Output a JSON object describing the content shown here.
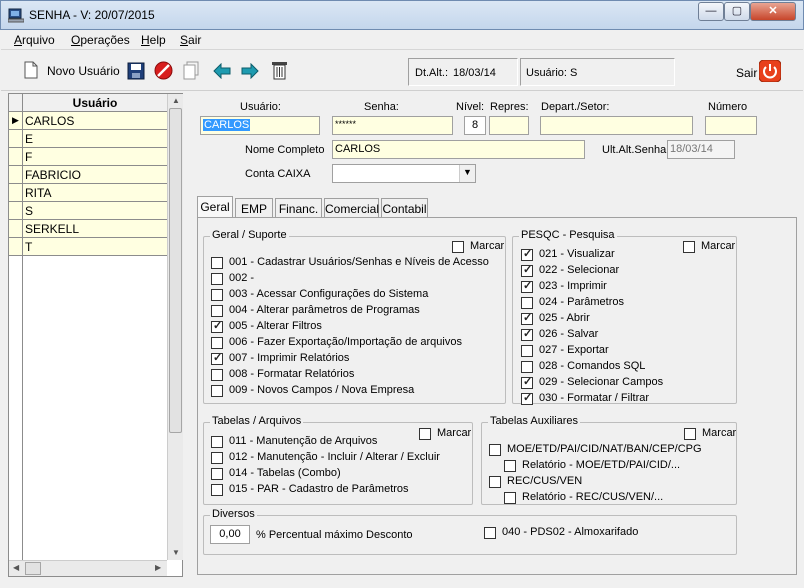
{
  "window": {
    "title": "SENHA - V: 20/07/2015",
    "minimize_glyph": "—",
    "maximize_glyph": "▢",
    "close_glyph": "✕"
  },
  "menu": {
    "items": [
      {
        "label": "Arquivo",
        "accel": "A",
        "rest": "rquivo"
      },
      {
        "label": "Operações",
        "accel": "O",
        "rest": "perações"
      },
      {
        "label": "Help",
        "accel": "H",
        "rest": "elp"
      },
      {
        "label": "Sair",
        "accel": "S",
        "rest": "air"
      }
    ]
  },
  "toolbar": {
    "new_user_label": "Novo Usuário",
    "dt_alt_label": "Dt.Alt.:",
    "dt_alt_value": "18/03/14",
    "usuario_label": "Usuário:",
    "usuario_value": "S",
    "exit_label": "Sair",
    "icons": [
      "new-document-icon",
      "save-icon",
      "cancel-icon",
      "copy-icon",
      "arrow-left-icon",
      "arrow-right-icon",
      "trash-icon",
      "power-icon"
    ]
  },
  "grid": {
    "header": "Usuário",
    "rows": [
      "CARLOS",
      "E",
      "F",
      "FABRICIO",
      "RITA",
      "S",
      "SERKELL",
      "T"
    ],
    "current_row_marker": "▶"
  },
  "form": {
    "usuario_label": "Usuário:",
    "usuario_value": "CARLOS",
    "senha_label": "Senha:",
    "senha_value": "******",
    "nivel_label": "Nível:",
    "nivel_value": "8",
    "repres_label": "Repres:",
    "repres_value": "",
    "depart_label": "Depart./Setor:",
    "depart_value": "",
    "numero_label": "Número",
    "numero_value": "",
    "nome_label": "Nome Completo",
    "nome_value": "CARLOS",
    "ult_alt_label": "Ult.Alt.Senha",
    "ult_alt_value": "18/03/14",
    "conta_label": "Conta CAIXA",
    "conta_value": ""
  },
  "tabs": [
    "Geral",
    "EMP",
    "Financ.",
    "Comercial",
    "Contabil"
  ],
  "groups": {
    "geral": {
      "title": "Geral / Suporte",
      "marcar": "Marcar",
      "items": [
        {
          "label": "001 - Cadastrar Usuários/Senhas e Níveis de Acesso",
          "checked": false
        },
        {
          "label": "002 -",
          "checked": false
        },
        {
          "label": "003 - Acessar Configurações do Sistema",
          "checked": false
        },
        {
          "label": "004 - Alterar parâmetros de Programas",
          "checked": false
        },
        {
          "label": "005 - Alterar Filtros",
          "checked": true
        },
        {
          "label": "006 - Fazer Exportação/Importação de arquivos",
          "checked": false
        },
        {
          "label": "007 - Imprimir Relatórios",
          "checked": true
        },
        {
          "label": "008 - Formatar Relatórios",
          "checked": false
        },
        {
          "label": "009 - Novos Campos / Nova Empresa",
          "checked": false
        }
      ]
    },
    "pesqc": {
      "title": "PESQC - Pesquisa",
      "marcar": "Marcar",
      "items": [
        {
          "label": "021 - Visualizar",
          "checked": true
        },
        {
          "label": "022 - Selecionar",
          "checked": true
        },
        {
          "label": "023 - Imprimir",
          "checked": true
        },
        {
          "label": "024 - Parâmetros",
          "checked": false
        },
        {
          "label": "025 - Abrir",
          "checked": true
        },
        {
          "label": "026 - Salvar",
          "checked": true
        },
        {
          "label": "027 - Exportar",
          "checked": false
        },
        {
          "label": "028 - Comandos SQL",
          "checked": false
        },
        {
          "label": "029 - Selecionar Campos",
          "checked": true
        },
        {
          "label": "030 - Formatar / Filtrar",
          "checked": true
        }
      ]
    },
    "tabelas": {
      "title": "Tabelas / Arquivos",
      "marcar": "Marcar",
      "items": [
        {
          "label": "011 - Manutenção de Arquivos",
          "checked": false
        },
        {
          "label": "012 - Manutenção - Incluir / Alterar / Excluir",
          "checked": false
        },
        {
          "label": "014 - Tabelas (Combo)",
          "checked": false
        },
        {
          "label": "015 - PAR - Cadastro de  Parâmetros",
          "checked": false
        }
      ]
    },
    "auxiliares": {
      "title": "Tabelas Auxiliares",
      "marcar": "Marcar",
      "items": [
        {
          "label": "MOE/ETD/PAI/CID/NAT/BAN/CEP/CPG",
          "checked": false
        },
        {
          "label": "Relatório - MOE/ETD/PAI/CID/...",
          "checked": false
        },
        {
          "label": "REC/CUS/VEN",
          "checked": false
        },
        {
          "label": "Relatório - REC/CUS/VEN/...",
          "checked": false
        }
      ]
    },
    "diversos": {
      "title": "Diversos",
      "percent_value": "0,00",
      "percent_label": "% Percentual máximo Desconto",
      "pds_label": "040 - PDS02 - Almoxarifado",
      "pds_checked": false
    }
  }
}
